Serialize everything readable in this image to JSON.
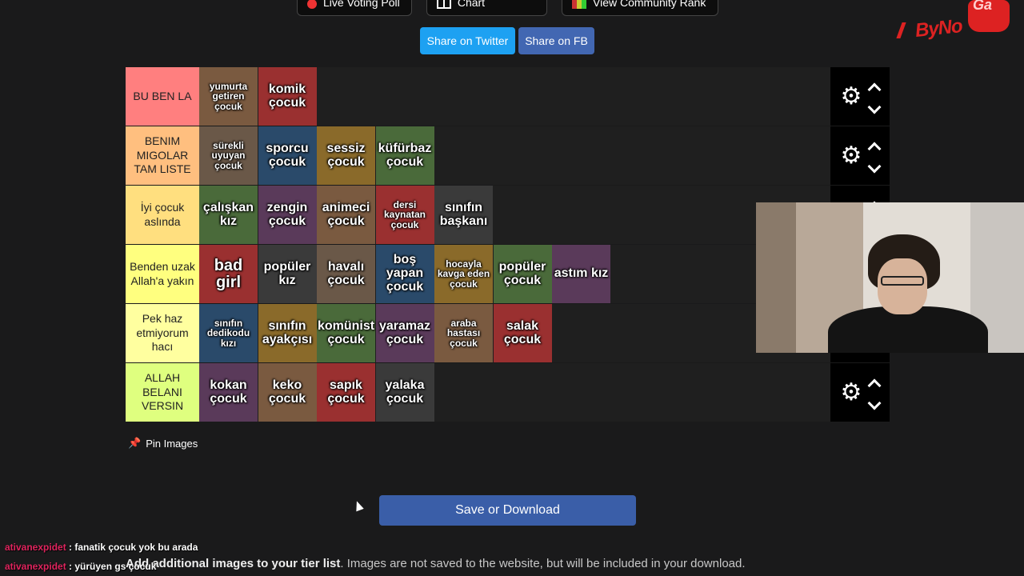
{
  "top_buttons": [
    {
      "label": "Live Voting Poll",
      "icon": "record-dot-icon"
    },
    {
      "label": "Alignment Chart",
      "icon": "grid-icon"
    },
    {
      "label": "View Community Rank",
      "icon": "rank-icon"
    }
  ],
  "share": {
    "twitter": "Share on Twitter",
    "facebook": "Share on FB"
  },
  "logo": {
    "text": "ByNo",
    "cap_text": "Ga"
  },
  "tiers": [
    {
      "label": "BU BEN LA",
      "color": "#ff7f7f",
      "items": [
        "yumurta getiren çocuk",
        "komik çocuk"
      ]
    },
    {
      "label": "BENIM MIGOLAR TAM LISTE",
      "color": "#ffbf7f",
      "items": [
        "sürekli uyuyan çocuk",
        "sporcu çocuk",
        "sessiz çocuk",
        "küfürbaz çocuk"
      ]
    },
    {
      "label": "İyi çocuk aslında",
      "color": "#ffdf7f",
      "items": [
        "çalışkan kız",
        "zengin çocuk",
        "animeci çocuk",
        "dersi kaynatan çocuk",
        "sınıfın başkanı"
      ]
    },
    {
      "label": "Benden uzak Allah'a yakın",
      "color": "#ffff7f",
      "items": [
        "bad girl",
        "popüler kız",
        "havalı çocuk",
        "boş yapan çocuk",
        "hocayla kavga eden çocuk",
        "popüler çocuk",
        "astım kız"
      ]
    },
    {
      "label": "Pek haz etmiyorum hacı",
      "color": "#ffff9f",
      "items": [
        "sınıfın dedikodu kızı",
        "sınıfın ayakçısı",
        "komünist çocuk",
        "yaramaz çocuk",
        "araba hastası çocuk",
        "salak çocuk"
      ]
    },
    {
      "label": "ALLAH BELANI VERSIN",
      "color": "#dfff7f",
      "items": [
        "kokan çocuk",
        "keko çocuk",
        "sapık çocuk",
        "yalaka çocuk"
      ]
    }
  ],
  "pin_images": "Pin Images",
  "save_button": "Save or Download",
  "add_text": {
    "bold": "Add additional images to your tier list",
    "rest": ". Images are not saved to the website, but will be included in your download."
  },
  "chat": [
    {
      "user": "ativanexpidet",
      "message": "fanatik çocuk yok bu arada"
    },
    {
      "user": "ativanexpidet",
      "message": "yürüyen gs çocuk"
    }
  ]
}
